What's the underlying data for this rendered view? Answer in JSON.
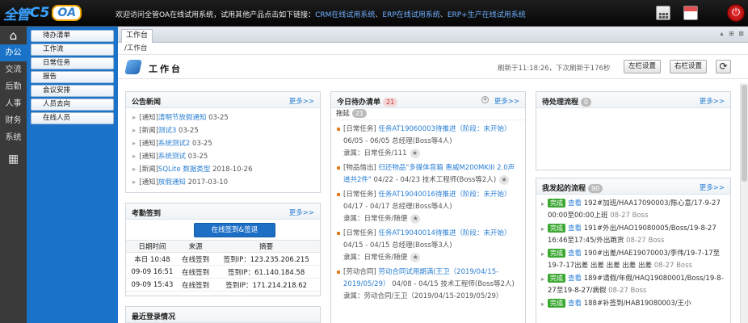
{
  "header": {
    "logo_main": "全管",
    "logo_c5": "C5",
    "logo_oa": "OA",
    "welcome": "欢迎访问全管OA在线试用系统，试用其他产品点击如下链接：",
    "links": [
      "CRM在线试用系统",
      "ERP在线试用系统",
      "ERP+生产在线试用系统"
    ],
    "separator": "、",
    "icons": [
      "calculator-icon",
      "calendar-icon",
      "power-icon"
    ]
  },
  "sidenav": {
    "home_icon": "⌂",
    "items": [
      "办公",
      "交流",
      "后勤",
      "人事",
      "财务",
      "系统"
    ],
    "active_index": 0,
    "apps_icon": "▦"
  },
  "submenu": {
    "items": [
      "待办清单",
      "工作流",
      "日常任务",
      "报告",
      "会议安排",
      "人员去向",
      "在线人员"
    ]
  },
  "tabs": {
    "active": "工作台",
    "controls": [
      "▴",
      "⊞",
      "⊠"
    ]
  },
  "breadcrumb": "/工作台",
  "page": {
    "title": "工作台",
    "refresh_info": "刷新于11:18:26，下次刷新于176秒",
    "left_settings": "左栏设置",
    "right_settings": "右栏设置",
    "refresh_icon": "⟳"
  },
  "news": {
    "title": "公告新闻",
    "more": "更多>>",
    "items": [
      {
        "prefix": "[通知]",
        "title": "清明节放假通知",
        "date": "03-25"
      },
      {
        "prefix": "[新闻]",
        "title": "测试3",
        "date": "03-25"
      },
      {
        "prefix": "[通知]",
        "title": "系统测试2",
        "date": "03-25"
      },
      {
        "prefix": "[通知]",
        "title": "系统测试",
        "date": "03-25"
      },
      {
        "prefix": "[新闻]",
        "title": "SQLite 数据类型",
        "date": "2018-10-26"
      },
      {
        "prefix": "[通知]",
        "title": "放假通知",
        "date": "2017-03-10"
      }
    ]
  },
  "attendance": {
    "title": "考勤签到",
    "more": "更多>>",
    "button": "在线签到&签退",
    "columns": [
      "日期时间",
      "来源",
      "摘要"
    ],
    "rows": [
      [
        "本日 10:48",
        "在线签到",
        "签到IP：123.235.206.215"
      ],
      [
        "09-09 16:51",
        "在线签到",
        "签到IP：61.140.184.58"
      ],
      [
        "09-09 15:43",
        "在线签到",
        "签到IP：171.214.218.62"
      ]
    ]
  },
  "login": {
    "title": "最近登录情况"
  },
  "todo": {
    "title": "今日待办清单",
    "count": "21",
    "more": "更多>>",
    "plus": "+",
    "sub_label": "拖延",
    "sub_count": "21",
    "items": [
      {
        "category": "[日常任务]",
        "link": "任务AT19060003待推进（阶段：未开始）",
        "time": "06/05 - 06/05",
        "person": "总经理(Boss等4人)",
        "extra": "隶属：日常任务/111"
      },
      {
        "category": "[物品借出]",
        "link": "归还物品\"多媒体音箱 惠威M200MKIII 2.0声道共2件\"",
        "time": "04/22 - 04/23",
        "person": "技术工程师(Boss等2人)",
        "extra": ""
      },
      {
        "category": "[日常任务]",
        "link": "任务AT19040016待推进（阶段：未开始）",
        "time": "04/17 - 04/17",
        "person": "总经理(Boss等4人)",
        "extra": "隶属：日常任务/随便"
      },
      {
        "category": "[日常任务]",
        "link": "任务AT19040014待推进（阶段：未开始）",
        "time": "04/15 - 04/15",
        "person": "总经理(Boss等3人)",
        "extra": "隶属：日常任务/随便"
      },
      {
        "category": "[劳动合同]",
        "link": "劳动合同试用期满(王卫（2019/04/15-2019/05/29）",
        "time": "04/08 - 04/15",
        "person": "技术工程师(Boss等2人)",
        "extra": "隶属：劳动合同/王卫（2019/04/15-2019/05/29）"
      }
    ],
    "star": "★"
  },
  "pending": {
    "title": "待处理流程",
    "count": "0",
    "more": "更多>>"
  },
  "myflows": {
    "title": "我发起的流程",
    "count": "90",
    "more": "更多>>",
    "items": [
      {
        "tag": "完成",
        "view": "查看",
        "text": "192#加班/HAA17090003/陈心意/17-9-27 00:00至00:00上班",
        "date": "08-27",
        "owner": "Boss"
      },
      {
        "tag": "完成",
        "view": "查看",
        "text": "191#外出/HAO19080005/Boss/19-8-27 16:46至17:45/外出跑货",
        "date": "08-27",
        "owner": "Boss"
      },
      {
        "tag": "完成",
        "view": "查看",
        "text": "190#出差/HAE19070003/李伟/19-7-17至19-7-17出差 出差 出差 出差 出差",
        "date": "08-27",
        "owner": "Boss"
      },
      {
        "tag": "完成",
        "view": "查看",
        "text": "189#请假/年假/HAQ19080001/Boss/19-8-27至19-8-27/病假",
        "date": "08-27",
        "owner": "Boss"
      },
      {
        "tag": "完成",
        "view": "查看",
        "text": "188#补签到/HAB19080003/王小",
        "date": "",
        "owner": ""
      }
    ]
  }
}
